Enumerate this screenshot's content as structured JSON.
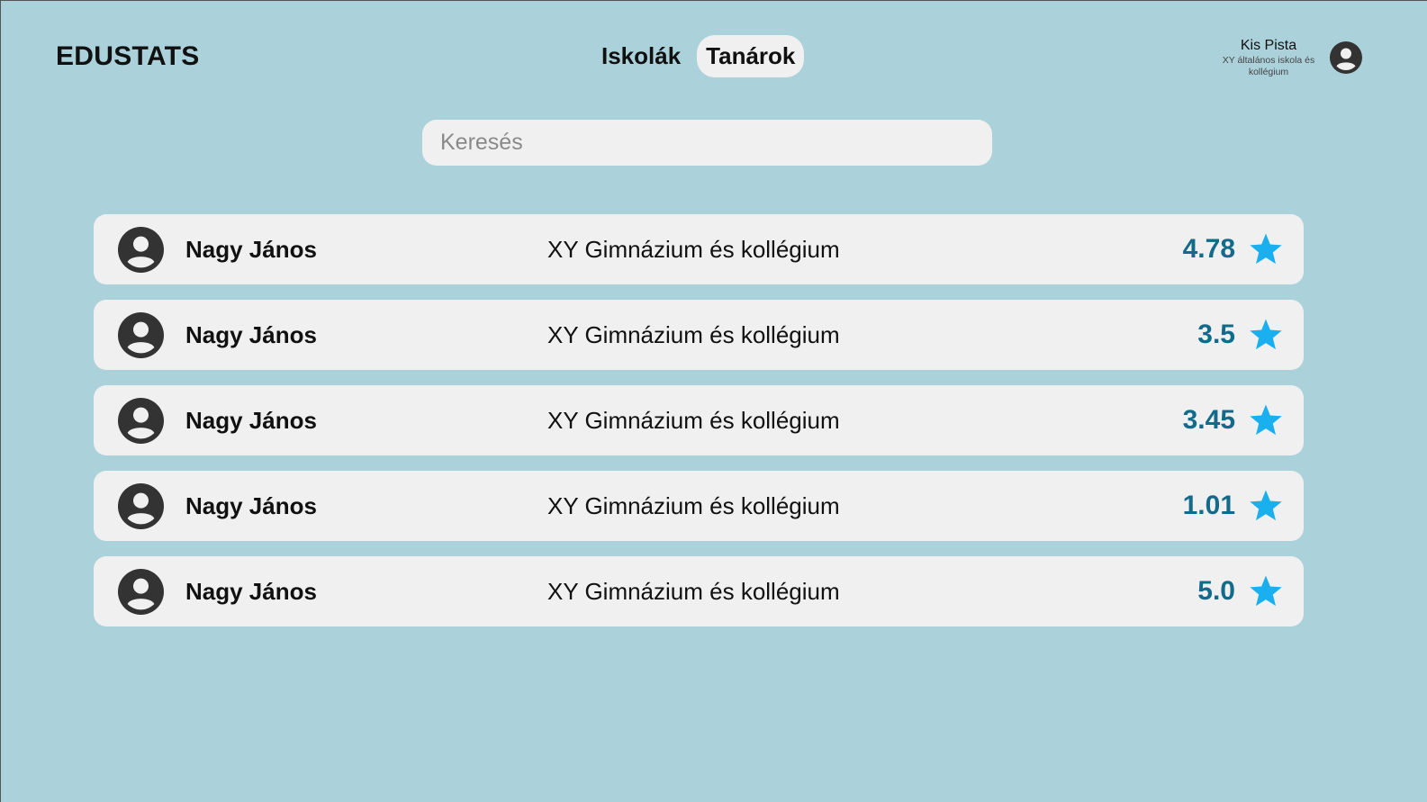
{
  "app": {
    "title": "EDUSTATS"
  },
  "nav": {
    "tabs": [
      {
        "label": "Iskolák",
        "active": false
      },
      {
        "label": "Tanárok",
        "active": true
      }
    ]
  },
  "user": {
    "name": "Kis Pista",
    "school": "XY általános iskola és kollégium",
    "icon": "account-circle-icon"
  },
  "search": {
    "placeholder": "Keresés",
    "value": ""
  },
  "teachers": [
    {
      "name": "Nagy János",
      "school": "XY Gimnázium és kollégium",
      "rating": "4.78"
    },
    {
      "name": "Nagy János",
      "school": "XY Gimnázium és kollégium",
      "rating": "3.5"
    },
    {
      "name": "Nagy János",
      "school": "XY Gimnázium és kollégium",
      "rating": "3.45"
    },
    {
      "name": "Nagy János",
      "school": "XY Gimnázium és kollégium",
      "rating": "1.01"
    },
    {
      "name": "Nagy János",
      "school": "XY Gimnázium és kollégium",
      "rating": "5.0"
    }
  ],
  "colors": {
    "background": "#abd1da",
    "card": "#f0f0f0",
    "rating_text": "#136a8a",
    "star": "#1ab0ef",
    "icon": "#333333"
  }
}
